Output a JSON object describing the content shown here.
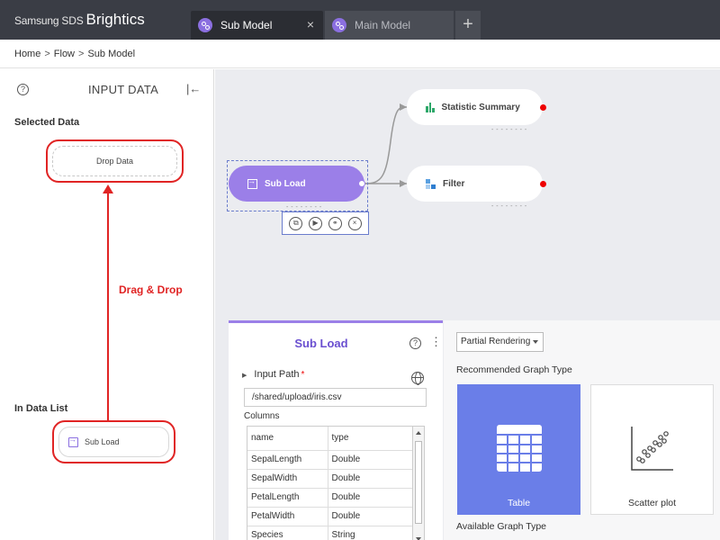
{
  "app": {
    "brand_prefix": "Samsung SDS",
    "brand_name": "Brightics"
  },
  "tabs": [
    {
      "label": "Sub Model",
      "active": true,
      "icon": "model-icon"
    },
    {
      "label": "Main Model",
      "active": false,
      "icon": "model-icon"
    }
  ],
  "tab_add_label": "+",
  "tab_close_label": "×",
  "breadcrumb": {
    "items": [
      "Home",
      "Flow",
      "Sub Model"
    ],
    "separator": ">"
  },
  "input_panel": {
    "help_label": "?",
    "title": "INPUT DATA",
    "collapse_icon": "collapse-left-icon",
    "collapse_label": "|←",
    "selected_label": "Selected Data",
    "drop_label": "Drop Data",
    "annotation": "Drag & Drop",
    "in_list_label": "In Data List",
    "in_list_item": "Sub Load"
  },
  "canvas": {
    "nodes": {
      "sub_load": "Sub Load",
      "statistic_summary": "Statistic Summary",
      "filter": "Filter"
    },
    "node_status_dots": "- - - - - - - -",
    "toolbar": {
      "copy_label": "⧉",
      "run_label": "▶",
      "model_label": "⚭",
      "delete_label": "×"
    }
  },
  "properties": {
    "title": "Sub Load",
    "help_label": "?",
    "more_label": "⋮",
    "input_path_label": "Input Path",
    "input_path_required": "*",
    "input_path_value": "/shared/upload/iris.csv",
    "columns_label": "Columns",
    "column_headers": [
      "name",
      "type"
    ],
    "columns": [
      {
        "name": "SepalLength",
        "type": "Double"
      },
      {
        "name": "SepalWidth",
        "type": "Double"
      },
      {
        "name": "PetalLength",
        "type": "Double"
      },
      {
        "name": "PetalWidth",
        "type": "Double"
      },
      {
        "name": "Species",
        "type": "String"
      }
    ]
  },
  "graph_panel": {
    "render_mode": "Partial Rendering",
    "recommended_label": "Recommended Graph Type",
    "cards": [
      {
        "label": "Table",
        "icon": "table-grid-icon",
        "selected": true
      },
      {
        "label": "Scatter plot",
        "icon": "scatter-plot-icon",
        "selected": false
      }
    ],
    "available_label": "Available Graph Type"
  },
  "colors": {
    "accent_purple": "#9b7fe8",
    "selected_card": "#6a7ee8",
    "annotation_red": "#e02424",
    "topbar": "#3a3d45"
  }
}
